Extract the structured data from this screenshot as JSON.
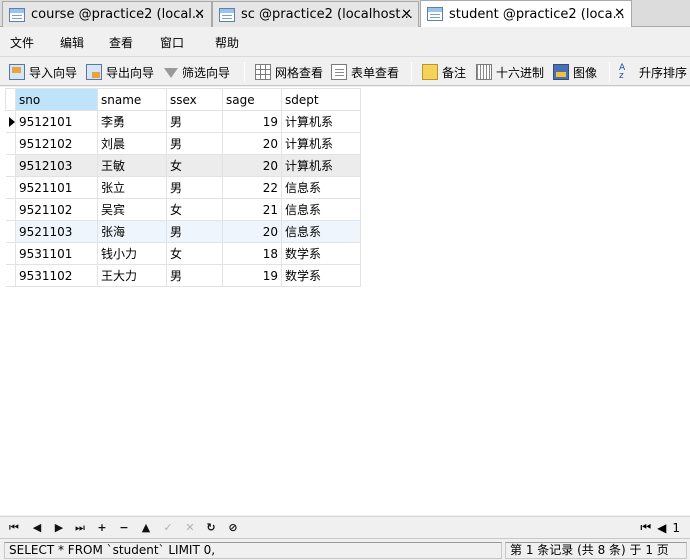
{
  "tabs": [
    {
      "label": "course @practice2 (local...",
      "close": "✕"
    },
    {
      "label": "sc @practice2 (localhost...",
      "close": "✕"
    },
    {
      "label": "student @practice2 (loca...",
      "close": "✕"
    }
  ],
  "menu": [
    "文件",
    "编辑",
    "查看",
    "窗口",
    "帮助"
  ],
  "toolbar": {
    "import_label": "导入向导",
    "export_label": "导出向导",
    "filter_label": "筛选向导",
    "grid_view_label": "网格查看",
    "form_view_label": "表单查看",
    "memo_label": "备注",
    "hex_label": "十六进制",
    "image_label": "图像",
    "sort_label": "升序排序"
  },
  "grid": {
    "columns": [
      "sno",
      "sname",
      "ssex",
      "sage",
      "sdept"
    ],
    "rows": [
      [
        "9512101",
        "李勇",
        "男",
        "19",
        "计算机系"
      ],
      [
        "9512102",
        "刘晨",
        "男",
        "20",
        "计算机系"
      ],
      [
        "9512103",
        "王敏",
        "女",
        "20",
        "计算机系"
      ],
      [
        "9521101",
        "张立",
        "男",
        "22",
        "信息系"
      ],
      [
        "9521102",
        "吴宾",
        "女",
        "21",
        "信息系"
      ],
      [
        "9521103",
        "张海",
        "男",
        "20",
        "信息系"
      ],
      [
        "9531101",
        "钱小力",
        "女",
        "18",
        "数学系"
      ],
      [
        "9531102",
        "王大力",
        "男",
        "19",
        "数学系"
      ]
    ]
  },
  "navigator": {
    "first": "⏮",
    "prev": "◀",
    "next": "▶",
    "last": "⏭",
    "add": "+",
    "delete": "−",
    "up": "▲",
    "apply": "✓",
    "cancel": "✕",
    "refresh": "↻",
    "stop": "⊘",
    "page_number": "1"
  },
  "status": {
    "sql": "SELECT * FROM `student` LIMIT 0,",
    "record_info": "第 1 条记录 (共 8 条) 于 1 页"
  }
}
